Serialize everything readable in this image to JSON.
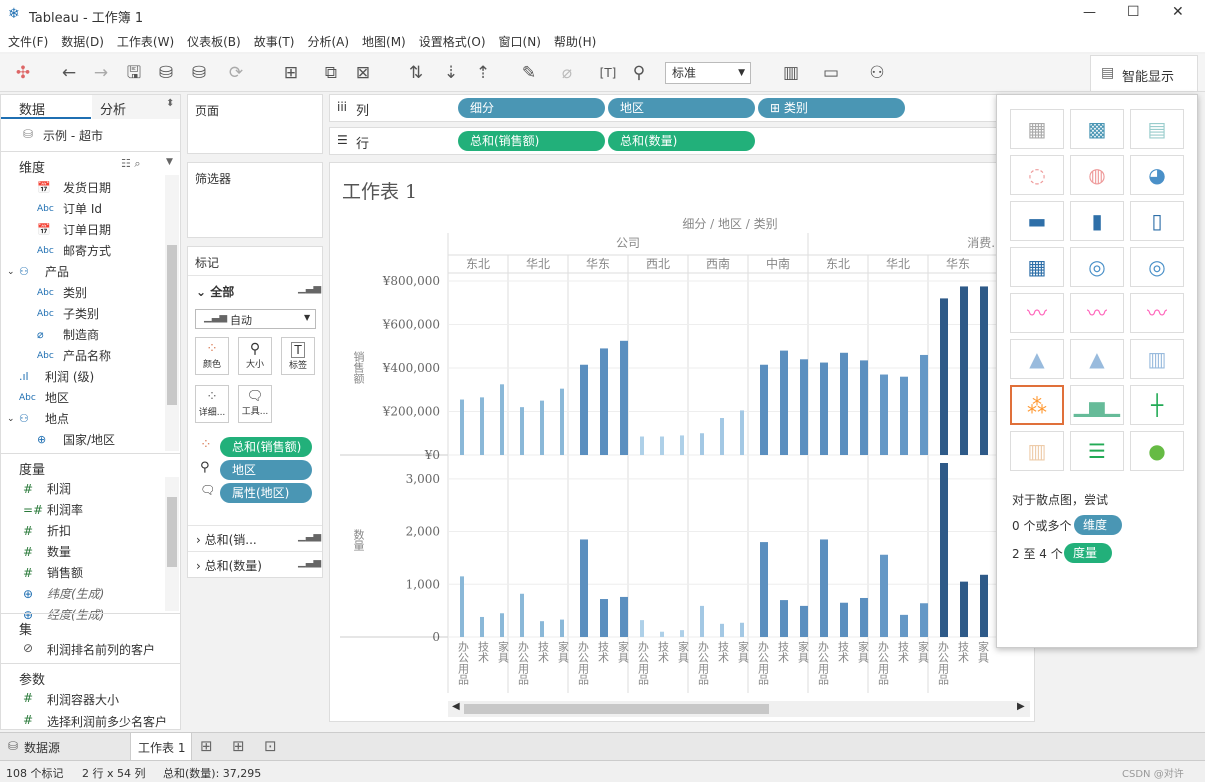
{
  "window": {
    "title": "Tableau - 工作簿 1",
    "minimize": "—",
    "maximize": "☐",
    "close": "✕"
  },
  "menu": [
    "文件(F)",
    "数据(D)",
    "工作表(W)",
    "仪表板(B)",
    "故事(T)",
    "分析(A)",
    "地图(M)",
    "设置格式(O)",
    "窗口(N)",
    "帮助(H)"
  ],
  "toolbar": {
    "fit_select": "标准",
    "show_me": "智能显示"
  },
  "data_pane": {
    "tab_data": "数据",
    "tab_analysis": "分析",
    "datasource": "示例 - 超市",
    "dimensions_header": "维度",
    "dimensions": [
      {
        "type": "date",
        "label": "发货日期",
        "indent": 1
      },
      {
        "type": "Abc",
        "label": "订单 Id",
        "indent": 1
      },
      {
        "type": "date",
        "label": "订单日期",
        "indent": 1
      },
      {
        "type": "Abc",
        "label": "邮寄方式",
        "indent": 1
      },
      {
        "type": "hier",
        "label": "产品",
        "indent": 0
      },
      {
        "type": "Abc",
        "label": "类别",
        "indent": 1
      },
      {
        "type": "Abc",
        "label": "子类别",
        "indent": 1
      },
      {
        "type": "clip",
        "label": "制造商",
        "indent": 1
      },
      {
        "type": "Abc",
        "label": "产品名称",
        "indent": 1
      },
      {
        "type": "bin",
        "label": "利润 (级)",
        "indent": 0
      },
      {
        "type": "Abc",
        "label": "地区",
        "indent": 0
      },
      {
        "type": "hier",
        "label": "地点",
        "indent": 0
      },
      {
        "type": "globe",
        "label": "国家/地区",
        "indent": 1
      }
    ],
    "measures_header": "度量",
    "measures": [
      {
        "type": "#",
        "label": "利润"
      },
      {
        "type": "=#",
        "label": "利润率"
      },
      {
        "type": "#",
        "label": "折扣"
      },
      {
        "type": "#",
        "label": "数量"
      },
      {
        "type": "#",
        "label": "销售额"
      },
      {
        "type": "globe",
        "label": "纬度(生成)"
      },
      {
        "type": "globe",
        "label": "经度(生成)"
      }
    ],
    "sets_header": "集",
    "sets": [
      "利润排名前列的客户"
    ],
    "params_header": "参数",
    "params": [
      "利润容器大小",
      "选择利润前多少名客户"
    ]
  },
  "cards": {
    "pages": "页面",
    "filters": "筛选器",
    "marks": "标记",
    "marks_all": "全部",
    "mark_type": "自动",
    "mark_buttons": [
      "颜色",
      "大小",
      "标签",
      "详细...",
      "工具..."
    ],
    "mark_pills": [
      "总和(销售额)",
      "地区",
      "属性(地区)"
    ],
    "sub_marks": [
      "总和(销...",
      "总和(数量)"
    ]
  },
  "shelves": {
    "columns_label": "列",
    "rows_label": "行",
    "columns": [
      "细分",
      "地区",
      "⊞ 类别"
    ],
    "rows": [
      "总和(销售额)",
      "总和(数量)"
    ]
  },
  "view": {
    "title": "工作表 1",
    "col_header": "细分 / 地区 / 类别",
    "segments": [
      "公司",
      "消费..."
    ],
    "regions": [
      "东北",
      "华北",
      "华东",
      "西北",
      "西南",
      "中南",
      "东北",
      "华北",
      "华东"
    ],
    "categories": [
      "办公用品",
      "技术",
      "家具"
    ],
    "sales_axis_label": "销售额",
    "sales_ticks": [
      "¥800,000",
      "¥600,000",
      "¥400,000",
      "¥200,000",
      "¥0"
    ],
    "qty_axis_label": "数量",
    "qty_ticks": [
      "3,000",
      "2,000",
      "1,000",
      "0"
    ]
  },
  "chart_data": {
    "type": "bar",
    "title": "工作表 1",
    "x": [
      "公司/东北/办公用品",
      "公司/东北/技术",
      "公司/东北/家具",
      "公司/华北/办公用品",
      "公司/华北/技术",
      "公司/华北/家具",
      "公司/华东/办公用品",
      "公司/华东/技术",
      "公司/华东/家具",
      "公司/西北/办公用品",
      "公司/西北/技术",
      "公司/西北/家具",
      "公司/西南/办公用品",
      "公司/西南/技术",
      "公司/西南/家具",
      "公司/中南/办公用品",
      "公司/中南/技术",
      "公司/中南/家具",
      "消费者/东北/办公用品",
      "消费者/东北/技术",
      "消费者/东北/家具",
      "消费者/华北/办公用品",
      "消费者/华北/技术",
      "消费者/华北/家具",
      "消费者/华东/办公用品",
      "消费者/华东/技术",
      "消费者/华东/家具"
    ],
    "series": [
      {
        "name": "总和(销售额)",
        "values": [
          255000,
          265000,
          325000,
          220000,
          250000,
          305000,
          415000,
          490000,
          525000,
          85000,
          85000,
          90000,
          100000,
          170000,
          205000,
          415000,
          480000,
          440000,
          425000,
          470000,
          435000,
          370000,
          360000,
          460000,
          720000,
          775000,
          775000
        ]
      },
      {
        "name": "总和(数量)",
        "values": [
          1150,
          380,
          450,
          820,
          300,
          330,
          1850,
          720,
          760,
          320,
          100,
          130,
          590,
          250,
          270,
          1800,
          700,
          590,
          1850,
          650,
          740,
          1560,
          420,
          640,
          3300,
          1050,
          1180
        ]
      }
    ],
    "colors": {
      "公司/东北": "#8ab8d8",
      "公司/华北": "#8ab8d8",
      "公司/华东": "#5b8fbf",
      "公司/西北": "#aed0e8",
      "公司/西南": "#a3c8e4",
      "公司/中南": "#5b8fbf",
      "消费者/东北": "#5b8fbf",
      "消费者/华北": "#6598c6",
      "消费者/华东": "#2e5a88"
    },
    "ylim_sales": [
      0,
      800000
    ],
    "ylim_qty": [
      0,
      3300
    ]
  },
  "show_me": {
    "hint": "对于散点图，尝试",
    "dims_line": "0 个或多个",
    "dims_pill": "维度",
    "meas_line": "2 至 4 个",
    "meas_pill": "度量"
  },
  "tabs": {
    "datasource": "数据源",
    "sheet1": "工作表 1"
  },
  "status": {
    "marks": "108 个标记",
    "dims": "2 行 x 54 列",
    "sum": "总和(数量): 37,295"
  },
  "watermark": "CSDN @对许"
}
